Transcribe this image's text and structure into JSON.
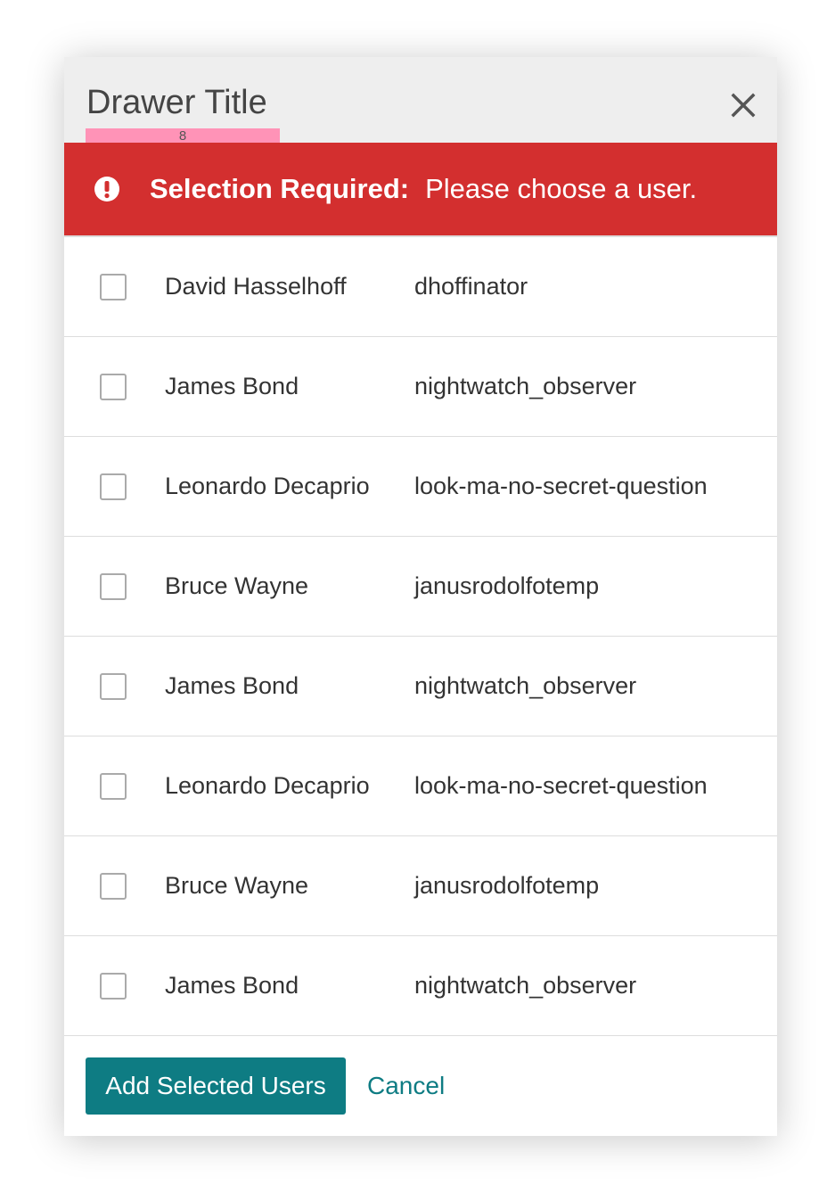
{
  "drawer": {
    "title": "Drawer Title",
    "badge": "8",
    "close_icon": "close-icon"
  },
  "alert": {
    "icon": "exclamation-circle-icon",
    "label": "Selection Required:",
    "message": "Please choose a user.",
    "color": "#d32f2f"
  },
  "users": [
    {
      "name": "David Hasselhoff",
      "username": "dhoffinator",
      "checked": false
    },
    {
      "name": "James Bond",
      "username": "nightwatch_observer",
      "checked": false
    },
    {
      "name": "Leonardo Decaprio",
      "username": "look-ma-no-secret-question",
      "checked": false
    },
    {
      "name": "Bruce Wayne",
      "username": "janusrodolfotemp",
      "checked": false
    },
    {
      "name": "James Bond",
      "username": "nightwatch_observer",
      "checked": false
    },
    {
      "name": "Leonardo Decaprio",
      "username": "look-ma-no-secret-question",
      "checked": false
    },
    {
      "name": "Bruce Wayne",
      "username": "janusrodolfotemp",
      "checked": false
    },
    {
      "name": "James Bond",
      "username": "nightwatch_observer",
      "checked": false
    }
  ],
  "footer": {
    "primary_label": "Add Selected Users",
    "cancel_label": "Cancel",
    "accent": "#0e7c83"
  }
}
